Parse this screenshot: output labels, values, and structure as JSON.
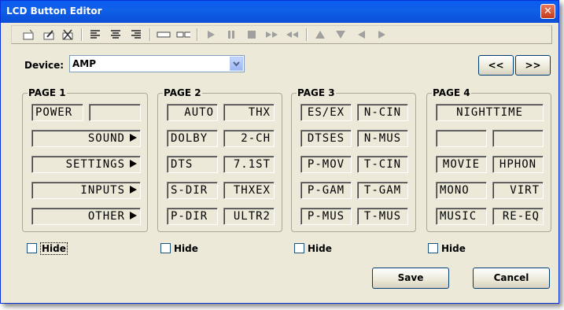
{
  "window": {
    "title": "LCD Button Editor"
  },
  "toolbar": {
    "icons": [
      "new-icon",
      "edit-icon",
      "delete-icon",
      "align-left-icon",
      "align-center-icon",
      "align-right-icon",
      "single-lcd-icon",
      "double-lcd-icon",
      "play-icon",
      "pause-icon",
      "stop-icon",
      "fast-forward-icon",
      "rewind-icon",
      "up-icon",
      "down-icon",
      "left-icon",
      "right-icon"
    ]
  },
  "device": {
    "label": "Device:",
    "value": "AMP"
  },
  "nav": {
    "prev": "<<",
    "next": ">>"
  },
  "pages": [
    {
      "title": "PAGE 1",
      "hide": "Hide",
      "buttons": [
        "POWER",
        "",
        "SOUND",
        "SETTINGS",
        "INPUTS",
        "OTHER"
      ]
    },
    {
      "title": "PAGE 2",
      "hide": "Hide",
      "buttons": [
        "AUTO",
        "THX",
        "DOLBY",
        "2-CH",
        "DTS",
        "7.1ST",
        "S-DIR",
        "THXEX",
        "P-DIR",
        "ULTR2"
      ]
    },
    {
      "title": "PAGE 3",
      "hide": "Hide",
      "buttons": [
        "ES/EX",
        "N-CIN",
        "DTSES",
        "N-MUS",
        "P-MOV",
        "T-CIN",
        "P-GAM",
        "T-GAM",
        "P-MUS",
        "T-MUS"
      ]
    },
    {
      "title": "PAGE 4",
      "hide": "Hide",
      "buttons": [
        "NIGHTTIME",
        "",
        "",
        "MOVIE",
        "HPHON",
        "MONO",
        "VIRT",
        "MUSIC",
        "RE-EQ"
      ]
    }
  ],
  "actions": {
    "save": "Save",
    "cancel": "Cancel"
  },
  "colors": {
    "titlebar": "#0a5bf0",
    "dialog": "#ece9d8"
  }
}
